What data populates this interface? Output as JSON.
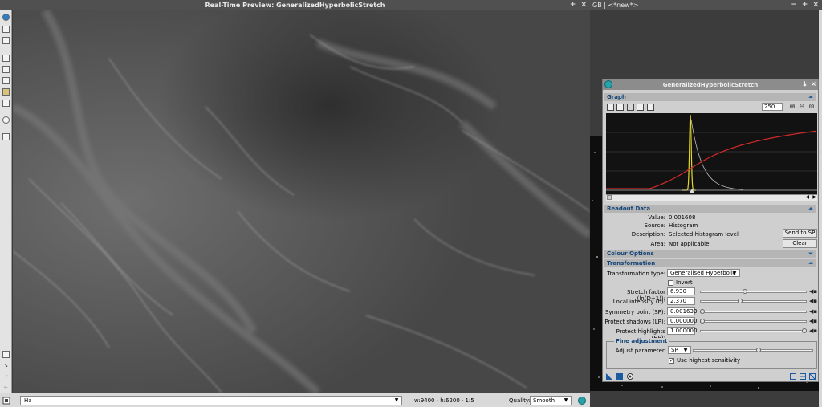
{
  "preview": {
    "title": "Real-Time Preview: GeneralizedHyperbolicStretch",
    "view_select": "Ha",
    "dimensions": "w:9400 · h:6200 · 1:5",
    "quality_label": "Quality:",
    "quality_value": "Smooth"
  },
  "workspace": {
    "title": "GB | <*new*>"
  },
  "dialog": {
    "title": "GeneralizedHyperbolicStretch",
    "graph": {
      "section_label": "Graph",
      "zoom_value": "250"
    },
    "readout": {
      "section_label": "Readout Data",
      "value_label": "Value:",
      "value": "0.001608",
      "source_label": "Source:",
      "source": "Histogram",
      "description_label": "Description:",
      "description": "Selected histogram level",
      "area_label": "Area:",
      "area": "Not applicable",
      "send_button": "Send to SP",
      "clear_button": "Clear"
    },
    "colour_options": {
      "section_label": "Colour Options"
    },
    "transformation": {
      "section_label": "Transformation",
      "type_label": "Transformation type:",
      "type_value": "Generalised Hyperbolic",
      "invert_label": "Invert",
      "invert_checked": false,
      "stretch_factor_label": "Stretch factor (ln(D+1)):",
      "stretch_factor": "6.930",
      "stretch_factor_level": 0.42,
      "local_intensity_label": "Local intensity (b):",
      "local_intensity": "2.370",
      "local_intensity_level": 0.37,
      "symmetry_point_label": "Symmetry point (SP):",
      "symmetry_point": "0.001633",
      "symmetry_point_level": 0.0,
      "protect_shadows_label": "Protect shadows (LP):",
      "protect_shadows": "0.000000",
      "protect_shadows_level": 0.0,
      "protect_highlights_label": "Protect highlights (HP):",
      "protect_highlights": "1.000000",
      "protect_highlights_level": 1.0
    },
    "fine_adjustment": {
      "section_label": "Fine adjustment",
      "adjust_label": "Adjust parameter:",
      "adjust_value": "SP",
      "adjust_level": 0.55,
      "highest_sensitivity_label": "Use highest sensitivity",
      "highest_sensitivity_checked": true
    }
  },
  "colors": {
    "transform_curve": "#d42a2a",
    "histogram": "#e4d82a",
    "accent": "#15477a"
  }
}
